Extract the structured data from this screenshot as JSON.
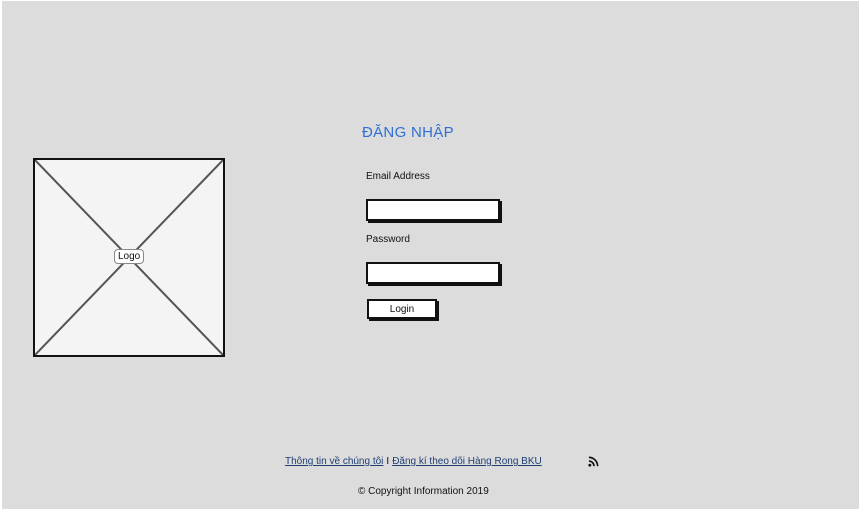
{
  "logo": {
    "label": "Logo"
  },
  "login": {
    "title": "ĐĂNG NHẬP",
    "email_label": "Email Address",
    "email_value": "",
    "password_label": "Password",
    "password_value": "",
    "button_label": "Login"
  },
  "footer": {
    "about_link": "Thông tin về chúng tôi",
    "separator": "I",
    "subscribe_link": "Đăng kí theo dõi Hàng Rong BKU",
    "rss_icon": "rss-icon",
    "copyright": "© Copyright Information 2019"
  },
  "colors": {
    "background": "#dcdcdc",
    "title": "#2f6fd6",
    "link": "#1e3f73"
  }
}
